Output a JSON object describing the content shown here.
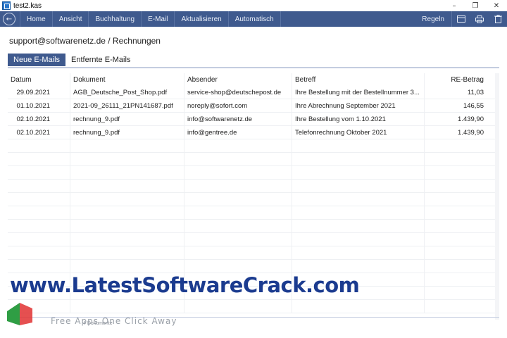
{
  "window": {
    "title": "test2.kas"
  },
  "menu": {
    "items": [
      "Home",
      "Ansicht",
      "Buchhaltung",
      "E-Mail",
      "Aktualisieren",
      "Automatisch"
    ],
    "rules_label": "Regeln",
    "toolbar_icons": [
      "window-icon",
      "printer-icon",
      "trash-icon"
    ]
  },
  "breadcrumb": "support@softwarenetz.de / Rechnungen",
  "tabs": [
    "Neue E-Mails",
    "Entfernte E-Mails"
  ],
  "active_tab": "Neue E-Mails",
  "table": {
    "columns": [
      "Datum",
      "Dokument",
      "Absender",
      "Betreff",
      "RE-Betrag"
    ],
    "rows": [
      [
        "29.09.2021",
        "AGB_Deutsche_Post_Shop.pdf",
        "service-shop@deutschepost.de",
        "Ihre Bestellung mit der Bestellnummer 3...",
        "11,03"
      ],
      [
        "01.10.2021",
        "2021-09_26111_21PN141687.pdf",
        "noreply@sofort.com",
        "Ihre Abrechnung September 2021",
        "146,55"
      ],
      [
        "02.10.2021",
        "rechnung_9.pdf",
        "info@softwarenetz.de",
        "Ihre Bestellung vom 1.10.2021",
        "1.439,90"
      ],
      [
        "02.10.2021",
        "rechnung_9.pdf",
        "info@gentree.de",
        "Telefonrechnung Oktober 2021",
        "1.439,90"
      ]
    ]
  },
  "status": "4 Dokumente",
  "watermark": {
    "main": "www.LatestSoftwareCrack.com",
    "sub": "Free Apps One Click Away"
  },
  "colors": {
    "accent": "#3f5a8e",
    "watermark": "#1b3b8f"
  }
}
